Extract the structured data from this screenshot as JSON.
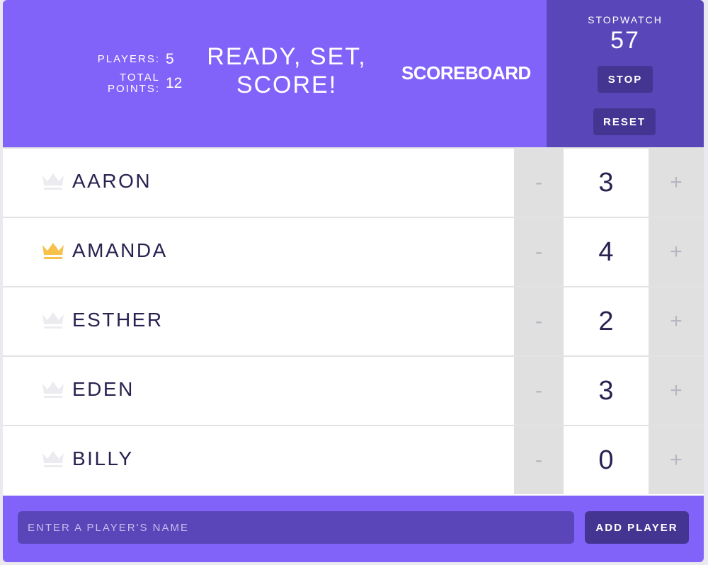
{
  "header": {
    "stats": {
      "players_label": "PLAYERS:",
      "players_value": "5",
      "points_label_line1": "TOTAL",
      "points_label_line2": "POINTS:",
      "points_value": "12"
    },
    "title_line1": "READY, SET,",
    "title_line2": "SCORE!",
    "scoreboard_label": "SCOREBOARD"
  },
  "stopwatch": {
    "label": "STOPWATCH",
    "time": "57",
    "stop_label": "STOP",
    "reset_label": "RESET"
  },
  "players": [
    {
      "name": "AARON",
      "score": "3",
      "crown": "crown-icon",
      "leader": false
    },
    {
      "name": "AMANDA",
      "score": "4",
      "crown": "crown-icon",
      "leader": true
    },
    {
      "name": "ESTHER",
      "score": "2",
      "crown": "crown-icon",
      "leader": false
    },
    {
      "name": "EDEN",
      "score": "3",
      "crown": "crown-icon",
      "leader": false
    },
    {
      "name": "BILLY",
      "score": "0",
      "crown": "crown-icon",
      "leader": false
    }
  ],
  "counter": {
    "decrement_label": "-",
    "increment_label": "+"
  },
  "footer": {
    "input_placeholder": "ENTER A PLAYER'S NAME",
    "input_value": "",
    "add_label": "ADD PLAYER"
  },
  "colors": {
    "header_bg": "#8163fa",
    "stopwatch_bg": "#5946b8",
    "button_bg": "#453593",
    "crown_leader": "#f7c14d",
    "crown_inactive": "#ececf0",
    "text_dark": "#2b2150"
  }
}
